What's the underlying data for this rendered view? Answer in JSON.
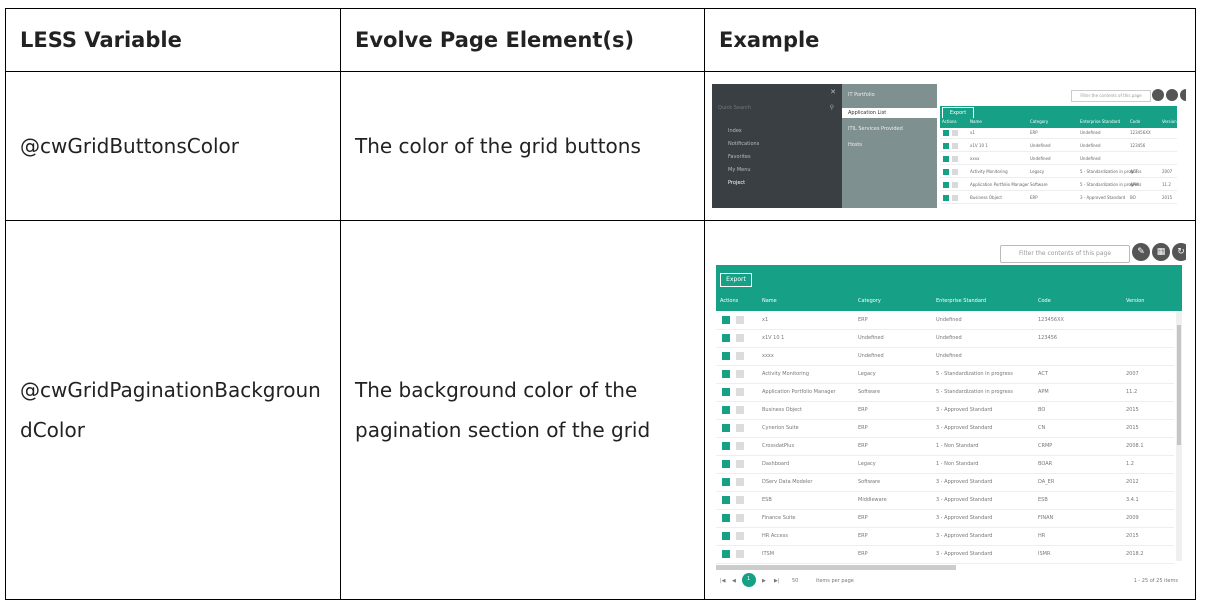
{
  "table": {
    "headers": [
      "LESS Variable",
      "Evolve Page Element(s)",
      "Example"
    ],
    "rows": [
      {
        "variable": "@cwGridButtonsColor",
        "element": "The color of the grid buttons"
      },
      {
        "variable": "@cwGridPaginationBackgroundColor",
        "element": "The background color of the pagination section of the grid"
      }
    ]
  },
  "screenshot1": {
    "search_placeholder": "Quick Search",
    "nav": [
      "Index",
      "Notifications",
      "Favorites",
      "My Menu",
      "Project"
    ],
    "subnav": [
      "IT Portfolio",
      "Application List",
      "ITIL Services Provided",
      "Hosts"
    ],
    "filter_placeholder": "Filter the contents of this page",
    "export_label": "Export",
    "columns": [
      "Actions",
      "Name",
      "Category",
      "Enterprise Standard",
      "Code",
      "Version"
    ],
    "rows": [
      [
        "x1",
        "ERP",
        "Undefined",
        "123456XX",
        ""
      ],
      [
        "x1V 10 1",
        "Undefined",
        "Undefined",
        "123456",
        ""
      ],
      [
        "xxxx",
        "Undefined",
        "Undefined",
        "",
        ""
      ],
      [
        "Activity Monitoring",
        "Legacy",
        "5 - Standardization in progress",
        "ACT",
        "2007"
      ],
      [
        "Application Portfolio Manager",
        "Software",
        "5 - Standardization in progress",
        "APM",
        "11.2"
      ],
      [
        "Business Object",
        "ERP",
        "3 - Approved Standard",
        "BO",
        "2015"
      ]
    ],
    "accent": "#16a085"
  },
  "screenshot2": {
    "filter_placeholder": "Filter the contents of this page",
    "export_label": "Export",
    "columns": [
      "Actions",
      "Name",
      "Category",
      "Enterprise Standard",
      "Code",
      "Version"
    ],
    "rows": [
      [
        "x1",
        "ERP",
        "Undefined",
        "123456XX",
        ""
      ],
      [
        "x1V 10 1",
        "Undefined",
        "Undefined",
        "123456",
        ""
      ],
      [
        "xxxx",
        "Undefined",
        "Undefined",
        "",
        ""
      ],
      [
        "Activity Monitoring",
        "Legacy",
        "5 - Standardization in progress",
        "ACT",
        "2007"
      ],
      [
        "Application Portfolio Manager",
        "Software",
        "5 - Standardization in progress",
        "APM",
        "11.2"
      ],
      [
        "Business Object",
        "ERP",
        "3 - Approved Standard",
        "BO",
        "2015"
      ],
      [
        "Cynerion Suite",
        "ERP",
        "3 - Approved Standard",
        "CN",
        "2015"
      ],
      [
        "CrossdatPlus",
        "ERP",
        "1 - Non Standard",
        "CRMP",
        "2008.1"
      ],
      [
        "Dashboard",
        "Legacy",
        "1 - Non Standard",
        "BOAR",
        "1.2"
      ],
      [
        "DServ Data Modeler",
        "Software",
        "3 - Approved Standard",
        "DA_ER",
        "2012"
      ],
      [
        "ESB",
        "Middleware",
        "3 - Approved Standard",
        "ESB",
        "3.4.1"
      ],
      [
        "Finance Suite",
        "ERP",
        "3 - Approved Standard",
        "FINAN",
        "2009"
      ],
      [
        "HR Access",
        "ERP",
        "3 - Approved Standard",
        "HR",
        "2015"
      ],
      [
        "ITSM",
        "ERP",
        "3 - Approved Standard",
        "ISMR",
        "2018.2"
      ]
    ],
    "pagination": {
      "current_page": "1",
      "page_size": "50",
      "per_page_label": "items per page",
      "summary": "1 - 25 of 25 items"
    },
    "accent": "#16a085"
  }
}
